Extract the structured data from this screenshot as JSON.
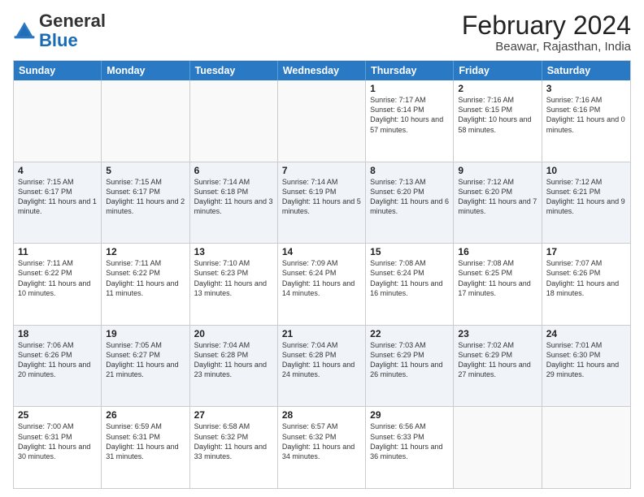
{
  "header": {
    "logo_general": "General",
    "logo_blue": "Blue",
    "month_year": "February 2024",
    "location": "Beawar, Rajasthan, India"
  },
  "days": [
    "Sunday",
    "Monday",
    "Tuesday",
    "Wednesday",
    "Thursday",
    "Friday",
    "Saturday"
  ],
  "rows": [
    [
      {
        "date": "",
        "info": ""
      },
      {
        "date": "",
        "info": ""
      },
      {
        "date": "",
        "info": ""
      },
      {
        "date": "",
        "info": ""
      },
      {
        "date": "1",
        "info": "Sunrise: 7:17 AM\nSunset: 6:14 PM\nDaylight: 10 hours and 57 minutes."
      },
      {
        "date": "2",
        "info": "Sunrise: 7:16 AM\nSunset: 6:15 PM\nDaylight: 10 hours and 58 minutes."
      },
      {
        "date": "3",
        "info": "Sunrise: 7:16 AM\nSunset: 6:16 PM\nDaylight: 11 hours and 0 minutes."
      }
    ],
    [
      {
        "date": "4",
        "info": "Sunrise: 7:15 AM\nSunset: 6:17 PM\nDaylight: 11 hours and 1 minute."
      },
      {
        "date": "5",
        "info": "Sunrise: 7:15 AM\nSunset: 6:17 PM\nDaylight: 11 hours and 2 minutes."
      },
      {
        "date": "6",
        "info": "Sunrise: 7:14 AM\nSunset: 6:18 PM\nDaylight: 11 hours and 3 minutes."
      },
      {
        "date": "7",
        "info": "Sunrise: 7:14 AM\nSunset: 6:19 PM\nDaylight: 11 hours and 5 minutes."
      },
      {
        "date": "8",
        "info": "Sunrise: 7:13 AM\nSunset: 6:20 PM\nDaylight: 11 hours and 6 minutes."
      },
      {
        "date": "9",
        "info": "Sunrise: 7:12 AM\nSunset: 6:20 PM\nDaylight: 11 hours and 7 minutes."
      },
      {
        "date": "10",
        "info": "Sunrise: 7:12 AM\nSunset: 6:21 PM\nDaylight: 11 hours and 9 minutes."
      }
    ],
    [
      {
        "date": "11",
        "info": "Sunrise: 7:11 AM\nSunset: 6:22 PM\nDaylight: 11 hours and 10 minutes."
      },
      {
        "date": "12",
        "info": "Sunrise: 7:11 AM\nSunset: 6:22 PM\nDaylight: 11 hours and 11 minutes."
      },
      {
        "date": "13",
        "info": "Sunrise: 7:10 AM\nSunset: 6:23 PM\nDaylight: 11 hours and 13 minutes."
      },
      {
        "date": "14",
        "info": "Sunrise: 7:09 AM\nSunset: 6:24 PM\nDaylight: 11 hours and 14 minutes."
      },
      {
        "date": "15",
        "info": "Sunrise: 7:08 AM\nSunset: 6:24 PM\nDaylight: 11 hours and 16 minutes."
      },
      {
        "date": "16",
        "info": "Sunrise: 7:08 AM\nSunset: 6:25 PM\nDaylight: 11 hours and 17 minutes."
      },
      {
        "date": "17",
        "info": "Sunrise: 7:07 AM\nSunset: 6:26 PM\nDaylight: 11 hours and 18 minutes."
      }
    ],
    [
      {
        "date": "18",
        "info": "Sunrise: 7:06 AM\nSunset: 6:26 PM\nDaylight: 11 hours and 20 minutes."
      },
      {
        "date": "19",
        "info": "Sunrise: 7:05 AM\nSunset: 6:27 PM\nDaylight: 11 hours and 21 minutes."
      },
      {
        "date": "20",
        "info": "Sunrise: 7:04 AM\nSunset: 6:28 PM\nDaylight: 11 hours and 23 minutes."
      },
      {
        "date": "21",
        "info": "Sunrise: 7:04 AM\nSunset: 6:28 PM\nDaylight: 11 hours and 24 minutes."
      },
      {
        "date": "22",
        "info": "Sunrise: 7:03 AM\nSunset: 6:29 PM\nDaylight: 11 hours and 26 minutes."
      },
      {
        "date": "23",
        "info": "Sunrise: 7:02 AM\nSunset: 6:29 PM\nDaylight: 11 hours and 27 minutes."
      },
      {
        "date": "24",
        "info": "Sunrise: 7:01 AM\nSunset: 6:30 PM\nDaylight: 11 hours and 29 minutes."
      }
    ],
    [
      {
        "date": "25",
        "info": "Sunrise: 7:00 AM\nSunset: 6:31 PM\nDaylight: 11 hours and 30 minutes."
      },
      {
        "date": "26",
        "info": "Sunrise: 6:59 AM\nSunset: 6:31 PM\nDaylight: 11 hours and 31 minutes."
      },
      {
        "date": "27",
        "info": "Sunrise: 6:58 AM\nSunset: 6:32 PM\nDaylight: 11 hours and 33 minutes."
      },
      {
        "date": "28",
        "info": "Sunrise: 6:57 AM\nSunset: 6:32 PM\nDaylight: 11 hours and 34 minutes."
      },
      {
        "date": "29",
        "info": "Sunrise: 6:56 AM\nSunset: 6:33 PM\nDaylight: 11 hours and 36 minutes."
      },
      {
        "date": "",
        "info": ""
      },
      {
        "date": "",
        "info": ""
      }
    ]
  ]
}
